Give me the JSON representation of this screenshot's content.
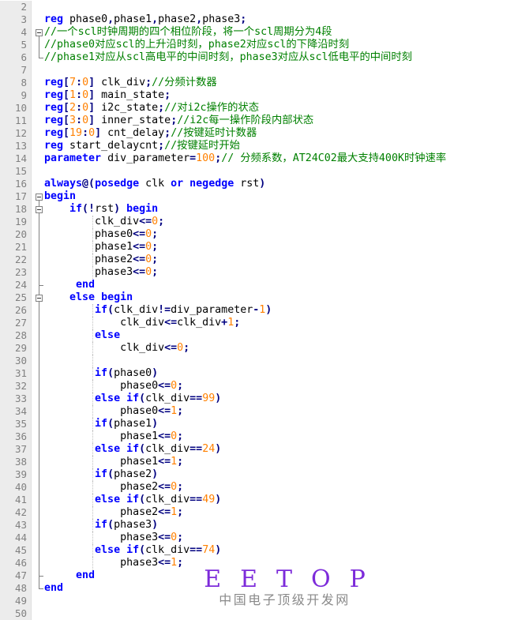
{
  "colors": {
    "kw": "#0000ff",
    "op": "#000080",
    "num": "#ff8000",
    "com": "#008000",
    "id": "#000000",
    "gutter_bg": "#ececec",
    "gutter_fg": "#808080",
    "gutter_border": "#dedede",
    "fold_line": "#808080",
    "guide": "#c0c0c0",
    "brand": "#7d2bda",
    "brand_sub": "#8a8a8a"
  },
  "watermark": {
    "title": "EETOP",
    "subtitle": "中国电子顶级开发网"
  },
  "editor": {
    "lines": [
      {
        "n": "2",
        "fold": "none",
        "g": false,
        "seg": []
      },
      {
        "n": "3",
        "fold": "none",
        "g": false,
        "seg": [
          [
            "k",
            "reg"
          ],
          [
            "i",
            " phase0"
          ],
          [
            "o",
            ","
          ],
          [
            "i",
            "phase1"
          ],
          [
            "o",
            ","
          ],
          [
            "i",
            "phase2"
          ],
          [
            "o",
            ","
          ],
          [
            "i",
            "phase3"
          ],
          [
            "o",
            ";"
          ]
        ]
      },
      {
        "n": "4",
        "fold": "box-below",
        "g": false,
        "seg": [
          [
            "c",
            "//一个scl时钟周期的四个相位阶段，将一个scl周期分为4段"
          ]
        ]
      },
      {
        "n": "5",
        "fold": "line",
        "g": false,
        "seg": [
          [
            "c",
            "//phase0对应scl的上升沿时刻，phase2对应scl的下降沿时刻"
          ]
        ]
      },
      {
        "n": "6",
        "fold": "corner",
        "g": false,
        "seg": [
          [
            "c",
            "//phase1对应从scl高电平的中间时刻，phase3对应从scl低电平的中间时刻"
          ]
        ]
      },
      {
        "n": "7",
        "fold": "none",
        "g": false,
        "seg": []
      },
      {
        "n": "8",
        "fold": "none",
        "g": false,
        "seg": [
          [
            "k",
            "reg"
          ],
          [
            "o",
            "["
          ],
          [
            "n",
            "7"
          ],
          [
            "o",
            ":"
          ],
          [
            "n",
            "0"
          ],
          [
            "o",
            "]"
          ],
          [
            "i",
            " clk_div"
          ],
          [
            "o",
            ";"
          ],
          [
            "c",
            "//分频计数器"
          ]
        ]
      },
      {
        "n": "9",
        "fold": "none",
        "g": false,
        "seg": [
          [
            "k",
            "reg"
          ],
          [
            "o",
            "["
          ],
          [
            "n",
            "1"
          ],
          [
            "o",
            ":"
          ],
          [
            "n",
            "0"
          ],
          [
            "o",
            "]"
          ],
          [
            "i",
            " main_state"
          ],
          [
            "o",
            ";"
          ]
        ]
      },
      {
        "n": "10",
        "fold": "none",
        "g": false,
        "seg": [
          [
            "k",
            "reg"
          ],
          [
            "o",
            "["
          ],
          [
            "n",
            "2"
          ],
          [
            "o",
            ":"
          ],
          [
            "n",
            "0"
          ],
          [
            "o",
            "]"
          ],
          [
            "i",
            " i2c_state"
          ],
          [
            "o",
            ";"
          ],
          [
            "c",
            "//对i2c操作的状态"
          ]
        ]
      },
      {
        "n": "11",
        "fold": "none",
        "g": false,
        "seg": [
          [
            "k",
            "reg"
          ],
          [
            "o",
            "["
          ],
          [
            "n",
            "3"
          ],
          [
            "o",
            ":"
          ],
          [
            "n",
            "0"
          ],
          [
            "o",
            "]"
          ],
          [
            "i",
            " inner_state"
          ],
          [
            "o",
            ";"
          ],
          [
            "c",
            "//i2c每一操作阶段内部状态"
          ]
        ]
      },
      {
        "n": "12",
        "fold": "none",
        "g": false,
        "seg": [
          [
            "k",
            "reg"
          ],
          [
            "o",
            "["
          ],
          [
            "n",
            "19"
          ],
          [
            "o",
            ":"
          ],
          [
            "n",
            "0"
          ],
          [
            "o",
            "]"
          ],
          [
            "i",
            " cnt_delay"
          ],
          [
            "o",
            ";"
          ],
          [
            "c",
            "//按键延时计数器"
          ]
        ]
      },
      {
        "n": "13",
        "fold": "none",
        "g": false,
        "seg": [
          [
            "k",
            "reg"
          ],
          [
            "i",
            " start_delaycnt"
          ],
          [
            "o",
            ";"
          ],
          [
            "c",
            "//按键延时开始"
          ]
        ]
      },
      {
        "n": "14",
        "fold": "none",
        "g": false,
        "seg": [
          [
            "k",
            "parameter"
          ],
          [
            "i",
            " div_parameter"
          ],
          [
            "o",
            "="
          ],
          [
            "n",
            "100"
          ],
          [
            "o",
            ";"
          ],
          [
            "c",
            "// 分频系数，AT24C02最大支持400K时钟速率"
          ]
        ]
      },
      {
        "n": "15",
        "fold": "none",
        "g": false,
        "seg": []
      },
      {
        "n": "16",
        "fold": "none",
        "g": false,
        "seg": [
          [
            "k",
            "always"
          ],
          [
            "o",
            "@("
          ],
          [
            "k",
            "posedge"
          ],
          [
            "i",
            " clk "
          ],
          [
            "k",
            "or"
          ],
          [
            "i",
            " "
          ],
          [
            "k",
            "negedge"
          ],
          [
            "i",
            " rst"
          ],
          [
            "o",
            ")"
          ]
        ]
      },
      {
        "n": "17",
        "fold": "box-below",
        "g": false,
        "seg": [
          [
            "k",
            "begin"
          ]
        ]
      },
      {
        "n": "18",
        "fold": "box-both",
        "g": false,
        "seg": [
          [
            "i",
            "    "
          ],
          [
            "k",
            "if"
          ],
          [
            "o",
            "(!"
          ],
          [
            "i",
            "rst"
          ],
          [
            "o",
            ")"
          ],
          [
            "i",
            " "
          ],
          [
            "k",
            "begin"
          ]
        ]
      },
      {
        "n": "19",
        "fold": "line",
        "g": true,
        "seg": [
          [
            "i",
            "        clk_div"
          ],
          [
            "o",
            "<="
          ],
          [
            "n",
            "0"
          ],
          [
            "o",
            ";"
          ]
        ]
      },
      {
        "n": "20",
        "fold": "line",
        "g": true,
        "seg": [
          [
            "i",
            "        phase0"
          ],
          [
            "o",
            "<="
          ],
          [
            "n",
            "0"
          ],
          [
            "o",
            ";"
          ]
        ]
      },
      {
        "n": "21",
        "fold": "line",
        "g": true,
        "seg": [
          [
            "i",
            "        phase1"
          ],
          [
            "o",
            "<="
          ],
          [
            "n",
            "0"
          ],
          [
            "o",
            ";"
          ]
        ]
      },
      {
        "n": "22",
        "fold": "line",
        "g": true,
        "seg": [
          [
            "i",
            "        phase2"
          ],
          [
            "o",
            "<="
          ],
          [
            "n",
            "0"
          ],
          [
            "o",
            ";"
          ]
        ]
      },
      {
        "n": "23",
        "fold": "line",
        "g": true,
        "seg": [
          [
            "i",
            "        phase3"
          ],
          [
            "o",
            "<="
          ],
          [
            "n",
            "0"
          ],
          [
            "o",
            ";"
          ]
        ]
      },
      {
        "n": "24",
        "fold": "tee",
        "g": false,
        "seg": [
          [
            "i",
            "     "
          ],
          [
            "k",
            "end"
          ]
        ]
      },
      {
        "n": "25",
        "fold": "box-both",
        "g": false,
        "seg": [
          [
            "i",
            "    "
          ],
          [
            "k",
            "else"
          ],
          [
            "i",
            " "
          ],
          [
            "k",
            "begin"
          ]
        ]
      },
      {
        "n": "26",
        "fold": "line",
        "g": true,
        "seg": [
          [
            "i",
            "        "
          ],
          [
            "k",
            "if"
          ],
          [
            "o",
            "("
          ],
          [
            "i",
            "clk_div"
          ],
          [
            "o",
            "!="
          ],
          [
            "i",
            "div_parameter"
          ],
          [
            "o",
            "-"
          ],
          [
            "n",
            "1"
          ],
          [
            "o",
            ")"
          ]
        ]
      },
      {
        "n": "27",
        "fold": "line",
        "g": true,
        "seg": [
          [
            "i",
            "            clk_div"
          ],
          [
            "o",
            "<="
          ],
          [
            "i",
            "clk_div"
          ],
          [
            "o",
            "+"
          ],
          [
            "n",
            "1"
          ],
          [
            "o",
            ";"
          ]
        ]
      },
      {
        "n": "28",
        "fold": "line",
        "g": true,
        "seg": [
          [
            "i",
            "        "
          ],
          [
            "k",
            "else"
          ]
        ]
      },
      {
        "n": "29",
        "fold": "line",
        "g": true,
        "seg": [
          [
            "i",
            "            clk_div"
          ],
          [
            "o",
            "<="
          ],
          [
            "n",
            "0"
          ],
          [
            "o",
            ";"
          ]
        ]
      },
      {
        "n": "30",
        "fold": "line",
        "g": true,
        "seg": []
      },
      {
        "n": "31",
        "fold": "line",
        "g": true,
        "seg": [
          [
            "i",
            "        "
          ],
          [
            "k",
            "if"
          ],
          [
            "o",
            "("
          ],
          [
            "i",
            "phase0"
          ],
          [
            "o",
            ")"
          ]
        ]
      },
      {
        "n": "32",
        "fold": "line",
        "g": true,
        "seg": [
          [
            "i",
            "            phase0"
          ],
          [
            "o",
            "<="
          ],
          [
            "n",
            "0"
          ],
          [
            "o",
            ";"
          ]
        ]
      },
      {
        "n": "33",
        "fold": "line",
        "g": true,
        "seg": [
          [
            "i",
            "        "
          ],
          [
            "k",
            "else"
          ],
          [
            "i",
            " "
          ],
          [
            "k",
            "if"
          ],
          [
            "o",
            "("
          ],
          [
            "i",
            "clk_div"
          ],
          [
            "o",
            "=="
          ],
          [
            "n",
            "99"
          ],
          [
            "o",
            ")"
          ]
        ]
      },
      {
        "n": "34",
        "fold": "line",
        "g": true,
        "seg": [
          [
            "i",
            "            phase0"
          ],
          [
            "o",
            "<="
          ],
          [
            "n",
            "1"
          ],
          [
            "o",
            ";"
          ]
        ]
      },
      {
        "n": "35",
        "fold": "line",
        "g": true,
        "seg": [
          [
            "i",
            "        "
          ],
          [
            "k",
            "if"
          ],
          [
            "o",
            "("
          ],
          [
            "i",
            "phase1"
          ],
          [
            "o",
            ")"
          ]
        ]
      },
      {
        "n": "36",
        "fold": "line",
        "g": true,
        "seg": [
          [
            "i",
            "            phase1"
          ],
          [
            "o",
            "<="
          ],
          [
            "n",
            "0"
          ],
          [
            "o",
            ";"
          ]
        ]
      },
      {
        "n": "37",
        "fold": "line",
        "g": true,
        "seg": [
          [
            "i",
            "        "
          ],
          [
            "k",
            "else"
          ],
          [
            "i",
            " "
          ],
          [
            "k",
            "if"
          ],
          [
            "o",
            "("
          ],
          [
            "i",
            "clk_div"
          ],
          [
            "o",
            "=="
          ],
          [
            "n",
            "24"
          ],
          [
            "o",
            ")"
          ]
        ]
      },
      {
        "n": "38",
        "fold": "line",
        "g": true,
        "seg": [
          [
            "i",
            "            phase1"
          ],
          [
            "o",
            "<="
          ],
          [
            "n",
            "1"
          ],
          [
            "o",
            ";"
          ]
        ]
      },
      {
        "n": "39",
        "fold": "line",
        "g": true,
        "seg": [
          [
            "i",
            "        "
          ],
          [
            "k",
            "if"
          ],
          [
            "o",
            "("
          ],
          [
            "i",
            "phase2"
          ],
          [
            "o",
            ")"
          ]
        ]
      },
      {
        "n": "40",
        "fold": "line",
        "g": true,
        "seg": [
          [
            "i",
            "            phase2"
          ],
          [
            "o",
            "<="
          ],
          [
            "n",
            "0"
          ],
          [
            "o",
            ";"
          ]
        ]
      },
      {
        "n": "41",
        "fold": "line",
        "g": true,
        "seg": [
          [
            "i",
            "        "
          ],
          [
            "k",
            "else"
          ],
          [
            "i",
            " "
          ],
          [
            "k",
            "if"
          ],
          [
            "o",
            "("
          ],
          [
            "i",
            "clk_div"
          ],
          [
            "o",
            "=="
          ],
          [
            "n",
            "49"
          ],
          [
            "o",
            ")"
          ]
        ]
      },
      {
        "n": "42",
        "fold": "line",
        "g": true,
        "seg": [
          [
            "i",
            "            phase2"
          ],
          [
            "o",
            "<="
          ],
          [
            "n",
            "1"
          ],
          [
            "o",
            ";"
          ]
        ]
      },
      {
        "n": "43",
        "fold": "line",
        "g": true,
        "seg": [
          [
            "i",
            "        "
          ],
          [
            "k",
            "if"
          ],
          [
            "o",
            "("
          ],
          [
            "i",
            "phase3"
          ],
          [
            "o",
            ")"
          ]
        ]
      },
      {
        "n": "44",
        "fold": "line",
        "g": true,
        "seg": [
          [
            "i",
            "            phase3"
          ],
          [
            "o",
            "<="
          ],
          [
            "n",
            "0"
          ],
          [
            "o",
            ";"
          ]
        ]
      },
      {
        "n": "45",
        "fold": "line",
        "g": true,
        "seg": [
          [
            "i",
            "        "
          ],
          [
            "k",
            "else"
          ],
          [
            "i",
            " "
          ],
          [
            "k",
            "if"
          ],
          [
            "o",
            "("
          ],
          [
            "i",
            "clk_div"
          ],
          [
            "o",
            "=="
          ],
          [
            "n",
            "74"
          ],
          [
            "o",
            ")"
          ]
        ]
      },
      {
        "n": "46",
        "fold": "line",
        "g": true,
        "seg": [
          [
            "i",
            "            phase3"
          ],
          [
            "o",
            "<="
          ],
          [
            "n",
            "1"
          ],
          [
            "o",
            ";"
          ]
        ]
      },
      {
        "n": "47",
        "fold": "tee",
        "g": false,
        "seg": [
          [
            "i",
            "     "
          ],
          [
            "k",
            "end"
          ]
        ]
      },
      {
        "n": "48",
        "fold": "corner",
        "g": false,
        "seg": [
          [
            "k",
            "end"
          ]
        ]
      },
      {
        "n": "49",
        "fold": "none",
        "g": false,
        "seg": []
      },
      {
        "n": "50",
        "fold": "none",
        "g": false,
        "seg": []
      }
    ]
  }
}
